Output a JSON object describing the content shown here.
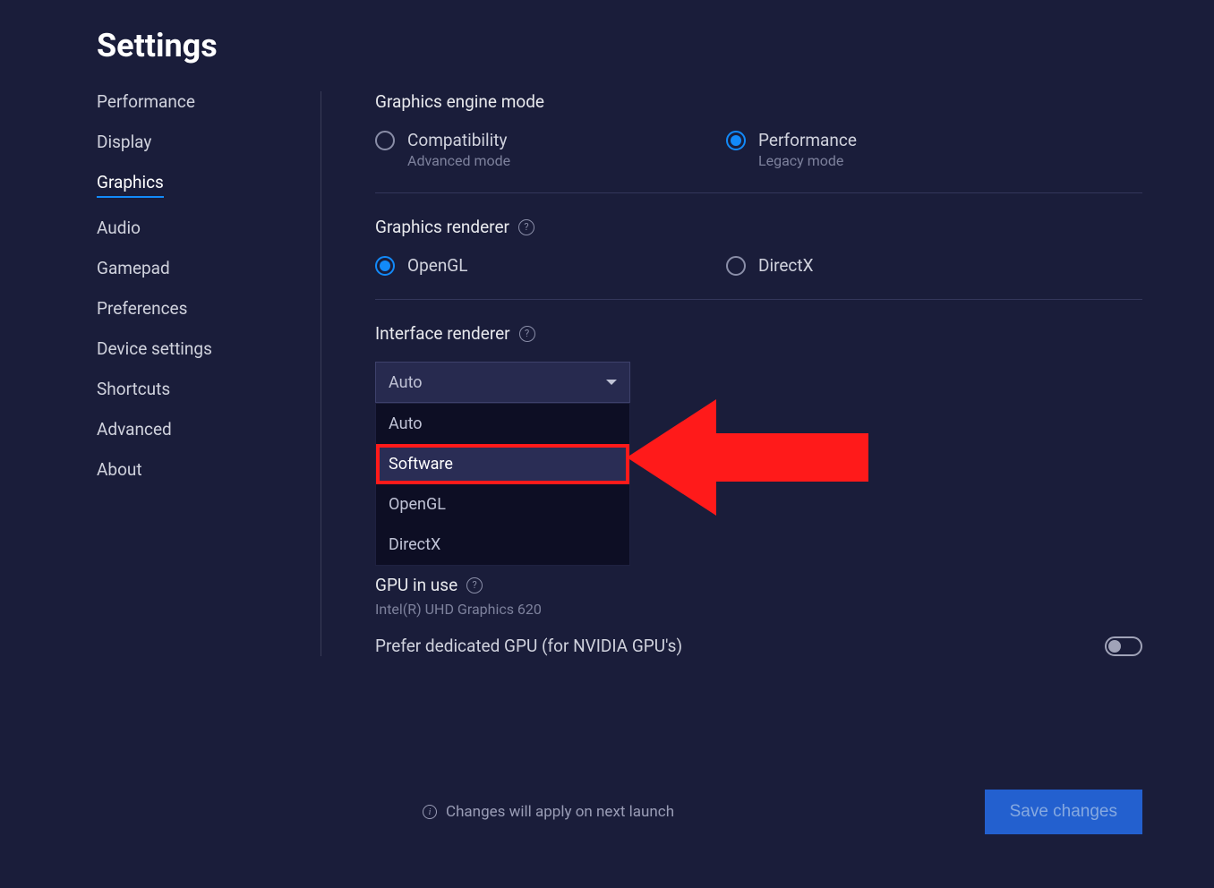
{
  "page_title": "Settings",
  "sidebar": {
    "items": [
      {
        "label": "Performance",
        "active": false
      },
      {
        "label": "Display",
        "active": false
      },
      {
        "label": "Graphics",
        "active": true
      },
      {
        "label": "Audio",
        "active": false
      },
      {
        "label": "Gamepad",
        "active": false
      },
      {
        "label": "Preferences",
        "active": false
      },
      {
        "label": "Device settings",
        "active": false
      },
      {
        "label": "Shortcuts",
        "active": false
      },
      {
        "label": "Advanced",
        "active": false
      },
      {
        "label": "About",
        "active": false
      }
    ]
  },
  "sections": {
    "engine_mode": {
      "title": "Graphics engine mode",
      "options": [
        {
          "label": "Compatibility",
          "sub": "Advanced mode",
          "selected": false
        },
        {
          "label": "Performance",
          "sub": "Legacy mode",
          "selected": true
        }
      ]
    },
    "renderer": {
      "title": "Graphics renderer",
      "options": [
        {
          "label": "OpenGL",
          "selected": true
        },
        {
          "label": "DirectX",
          "selected": false
        }
      ]
    },
    "interface_renderer": {
      "title": "Interface renderer",
      "selected": "Auto",
      "options": [
        "Auto",
        "Software",
        "OpenGL",
        "DirectX"
      ],
      "highlighted_option": "Software"
    },
    "gpu": {
      "title": "GPU in use",
      "value": "Intel(R) UHD Graphics 620"
    },
    "prefer_dedicated": {
      "label": "Prefer dedicated GPU (for NVIDIA GPU's)",
      "enabled": false
    }
  },
  "footer": {
    "notice": "Changes will apply on next launch",
    "save_label": "Save changes"
  }
}
